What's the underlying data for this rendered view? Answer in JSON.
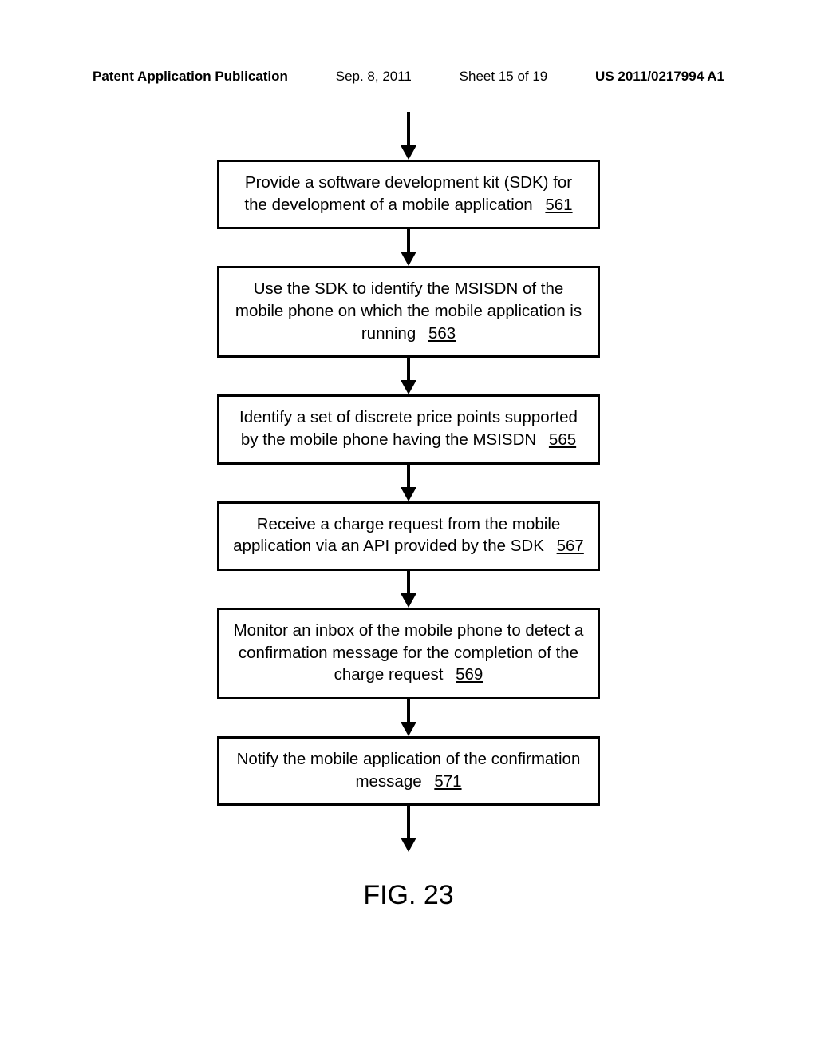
{
  "header": {
    "publication": "Patent Application Publication",
    "date": "Sep. 8, 2011",
    "sheet": "Sheet 15 of 19",
    "number": "US 2011/0217994 A1"
  },
  "steps": [
    {
      "text": "Provide a software development kit (SDK) for the development of a mobile application",
      "ref": "561"
    },
    {
      "text": "Use the SDK to identify the MSISDN of the mobile phone on which the mobile application is running",
      "ref": "563"
    },
    {
      "text": "Identify a set of discrete price points supported by the mobile phone having the MSISDN",
      "ref": "565"
    },
    {
      "text": "Receive a charge request from the mobile application via an API provided by the SDK",
      "ref": "567"
    },
    {
      "text": "Monitor an inbox of the mobile phone to detect a confirmation message for the completion of the charge request",
      "ref": "569"
    },
    {
      "text": "Notify the mobile application of the confirmation message",
      "ref": "571"
    }
  ],
  "figure_label": "FIG. 23",
  "chart_data": {
    "type": "flowchart",
    "title": "FIG. 23",
    "direction": "top-to-bottom",
    "nodes": [
      {
        "id": "561",
        "label": "Provide a software development kit (SDK) for the development of a mobile application"
      },
      {
        "id": "563",
        "label": "Use the SDK to identify the MSISDN of the mobile phone on which the mobile application is running"
      },
      {
        "id": "565",
        "label": "Identify a set of discrete price points supported by the mobile phone having the MSISDN"
      },
      {
        "id": "567",
        "label": "Receive a charge request from the mobile application via an API provided by the SDK"
      },
      {
        "id": "569",
        "label": "Monitor an inbox of the mobile phone to detect a confirmation message for the completion of the charge request"
      },
      {
        "id": "571",
        "label": "Notify the mobile application of the confirmation message"
      }
    ],
    "edges": [
      {
        "from": "entry",
        "to": "561"
      },
      {
        "from": "561",
        "to": "563"
      },
      {
        "from": "563",
        "to": "565"
      },
      {
        "from": "565",
        "to": "567"
      },
      {
        "from": "567",
        "to": "569"
      },
      {
        "from": "569",
        "to": "571"
      },
      {
        "from": "571",
        "to": "exit"
      }
    ]
  }
}
